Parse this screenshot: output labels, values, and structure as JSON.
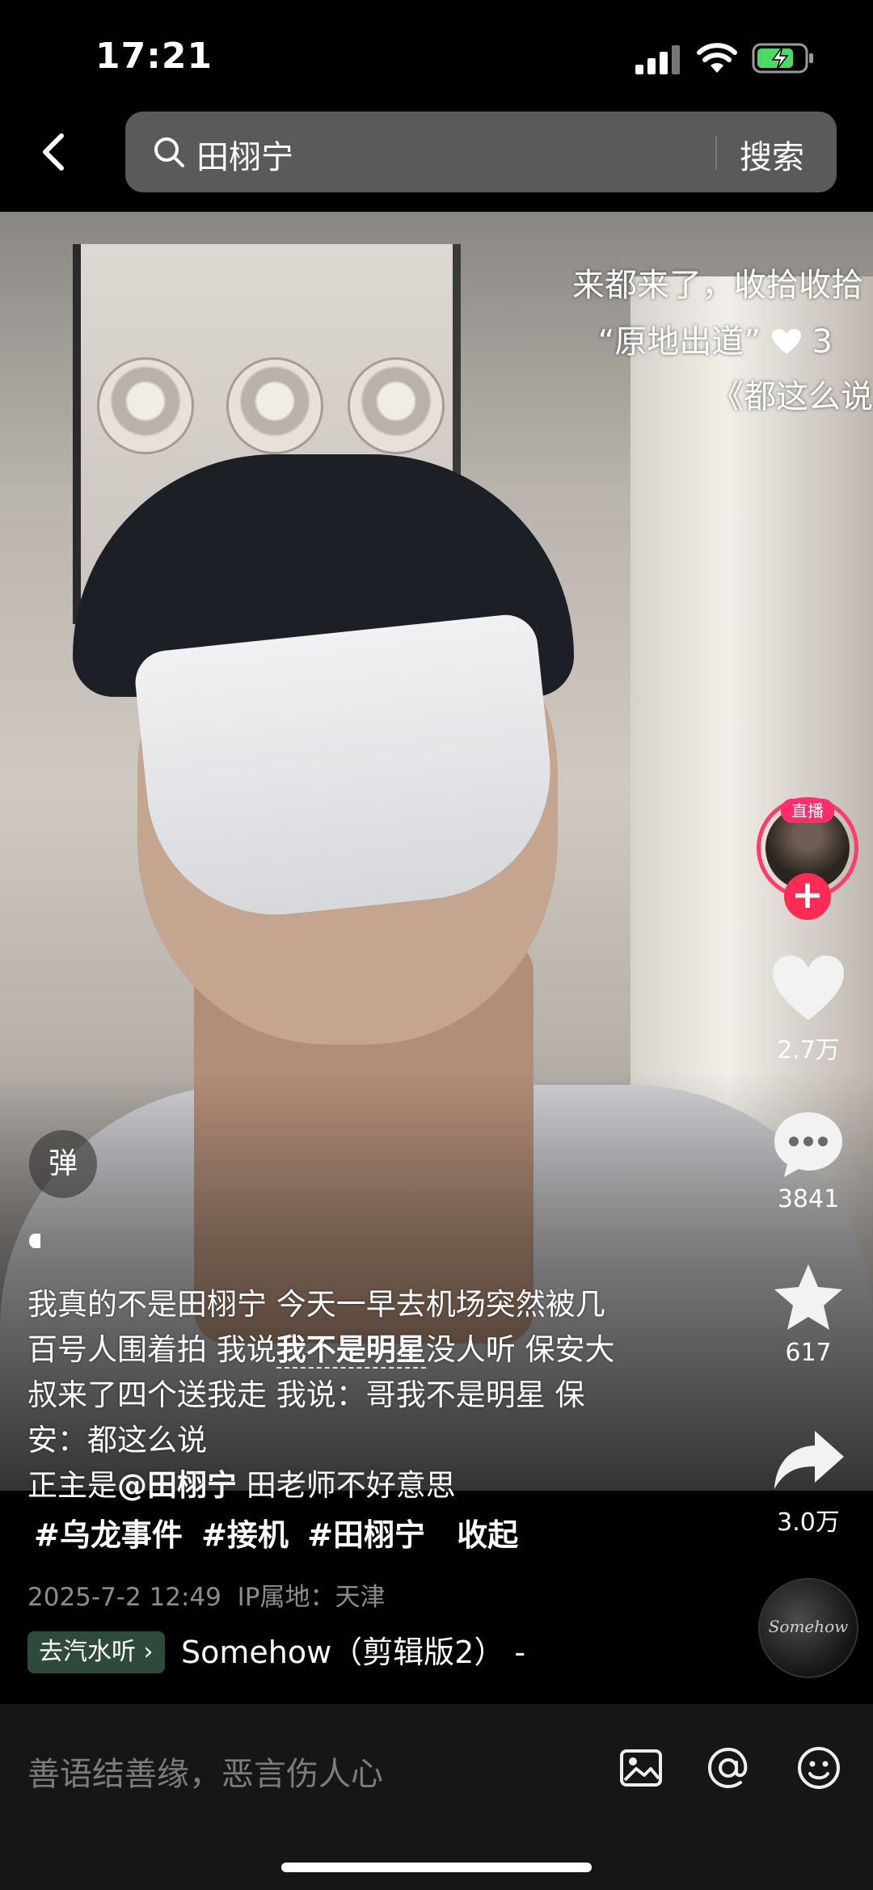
{
  "status_bar": {
    "time": "17:21"
  },
  "search": {
    "query": "田栩宁",
    "button": "搜索"
  },
  "danmaku": [
    {
      "text": "来都来了，收拾收拾",
      "suffix": ""
    },
    {
      "text": "“原地出道”",
      "suffix": "3"
    },
    {
      "text": "《都这么说",
      "suffix": ""
    }
  ],
  "creator": {
    "live_label": "直播",
    "follow_label": "+"
  },
  "actions": {
    "likes": "2.7万",
    "comments": "3841",
    "favorites": "617",
    "shares": "3.0万"
  },
  "danmu_toggle": "弹",
  "caption": {
    "line1": "我真的不是田栩宁 今天一早去机场突然被几",
    "line2a": "百号人围着拍 我说",
    "line2b": "我不是明星",
    "line2c": "没人听 保安大",
    "line3": "叔来了四个送我走 我说：哥我不是明星 保",
    "line4": "安：都这么说",
    "line5a": "正主是",
    "line5b": "@田栩宁",
    "line5c": " 田老师不好意思"
  },
  "hashtags": [
    "#乌龙事件",
    "#接机",
    "#田栩宁"
  ],
  "collapse_label": "收起",
  "meta": {
    "date": "2025-7-2 12:49",
    "ip": "IP属地：天津"
  },
  "music": {
    "pill": "去汽水听 ›",
    "title": "Somehow（剪辑版2）  -",
    "disc_label": "Somehow"
  },
  "comment_bar": {
    "placeholder": "善语结善缘，恶言伤人心"
  }
}
